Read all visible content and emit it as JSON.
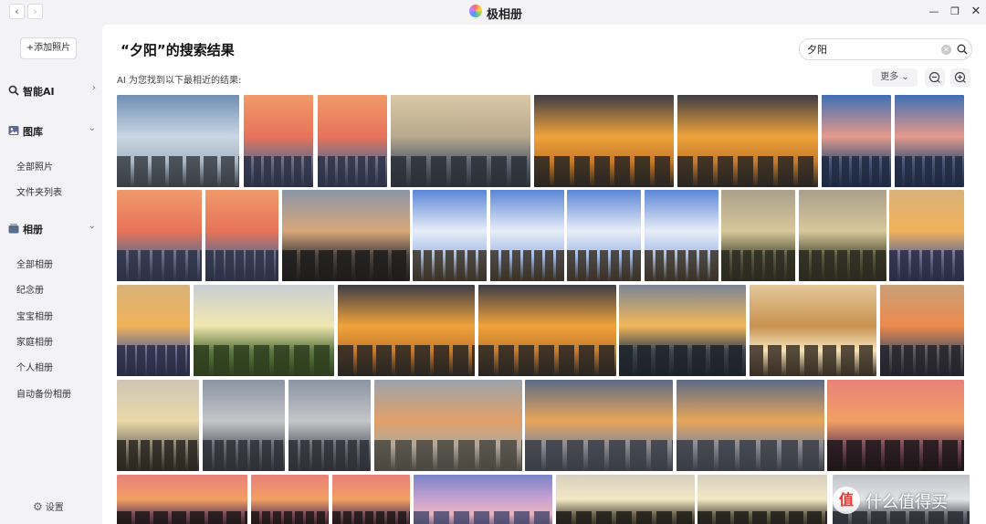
{
  "window": {
    "title": "极相册",
    "back_glyph": "‹",
    "forward_glyph": "›",
    "minimize_glyph": "—",
    "maximize_glyph": "❐",
    "close_glyph": "✕"
  },
  "sidebar": {
    "add_photo": "+添加照片",
    "sections": [
      {
        "label": "智能AI",
        "icon": "magnifier-icon",
        "chevron": "›"
      },
      {
        "label": "图库",
        "icon": "gallery-icon",
        "chevron": "⌄"
      },
      {
        "label": "相册",
        "icon": "album-icon",
        "chevron": "⌄"
      }
    ],
    "gallery_items": [
      "全部照片",
      "文件夹列表"
    ],
    "album_items": [
      "全部相册",
      "纪念册",
      "宝宝相册",
      "家庭相册",
      "个人相册",
      "自动备份相册"
    ],
    "settings": "设置",
    "settings_icon": "gear-icon"
  },
  "main": {
    "title": "“夕阳”的搜索结果",
    "search": {
      "value": "夕阳",
      "placeholder": ""
    },
    "ai_hint": "AI 为您找到以下最相近的结果:",
    "more": "更多 ⌄"
  },
  "photos": [
    "sky-clouds-building",
    "sunset-city-pink",
    "sunset-city-pink",
    "city-skyline-river",
    "sunset-buildings-orange",
    "sunset-buildings-orange",
    "city-pink-cloud",
    "city-pink-cloud",
    "sunset-city-pink",
    "sunset-city-pink",
    "dusk-building-silhouette",
    "building-blue-cloud",
    "building-blue-cloud",
    "building-blue-cloud",
    "building-blue-cloud",
    "trees-bare-dusk",
    "trees-bare-dusk",
    "sunset-mountain-city",
    "sunset-mountain-city",
    "green-field-sun",
    "sunset-buildings-orange",
    "sunset-buildings-orange",
    "dusk-overpass",
    "framed-sun-art",
    "tower-sunset",
    "palm-sun-haze",
    "hazy-mountain-city",
    "hazy-mountain-city",
    "sunset-haze-field",
    "town-dusk-clouds",
    "town-dusk-clouds",
    "palm-pink-sunset",
    "palm-pink-sunset",
    "palm-pink-sunset",
    "palm-pink-sunset",
    "purple-sky-lamp",
    "tree-silhouette-glow",
    "tree-silhouette-glow",
    "tower-grey"
  ],
  "colors": {
    "sidebar_bg": "#f3f3f5",
    "main_bg": "#ffffff",
    "accent": "#4d96ff"
  },
  "watermark": {
    "logo": "值",
    "text": "什么值得买"
  }
}
